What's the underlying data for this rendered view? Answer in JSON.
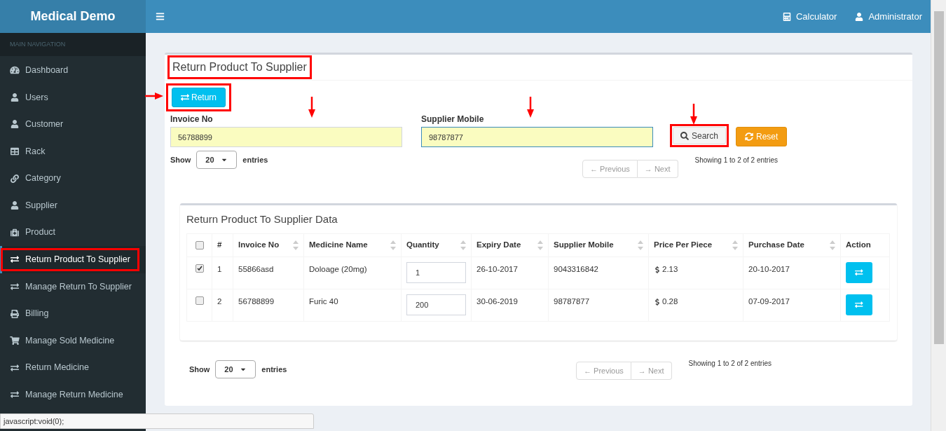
{
  "app": {
    "title": "Medical Demo"
  },
  "header": {
    "items": [
      "Calculator",
      "Administrator"
    ]
  },
  "sidebar": {
    "heading": "MAIN NAVIGATION",
    "items": [
      {
        "label": "Dashboard",
        "selected": false,
        "annotated": false
      },
      {
        "label": "Users",
        "selected": false,
        "annotated": false
      },
      {
        "label": "Customer",
        "selected": false,
        "annotated": false
      },
      {
        "label": "Rack",
        "selected": false,
        "annotated": false
      },
      {
        "label": "Category",
        "selected": false,
        "annotated": false
      },
      {
        "label": "Supplier",
        "selected": false,
        "annotated": false
      },
      {
        "label": "Product",
        "selected": false,
        "annotated": false
      },
      {
        "label": "Return Product To Supplier",
        "selected": true,
        "annotated": true
      },
      {
        "label": "Manage Return To Supplier",
        "selected": false,
        "annotated": false
      },
      {
        "label": "Billing",
        "selected": false,
        "annotated": false
      },
      {
        "label": "Manage Sold Medicine",
        "selected": false,
        "annotated": false
      },
      {
        "label": "Return Medicine",
        "selected": false,
        "annotated": false
      },
      {
        "label": "Manage Return Medicine",
        "selected": false,
        "annotated": false
      }
    ]
  },
  "panel": {
    "title": "Return Product To Supplier",
    "title_annotated": true,
    "return_button": {
      "label": "Return",
      "annotated": true
    },
    "fields": [
      {
        "label": "Invoice No",
        "value": "56788899",
        "focused": false
      },
      {
        "label": "Supplier Mobile",
        "value": "98787877",
        "focused": true
      }
    ],
    "search_button": {
      "label": "Search",
      "annotated": true
    },
    "reset_button": {
      "label": "Reset"
    },
    "top_length": {
      "show": "Show",
      "value": "20",
      "entries": "entries"
    },
    "top_pager": {
      "previous": "← Previous",
      "next": "→ Next"
    },
    "top_info": "Showing 1 to 2 of 2 entries"
  },
  "data_box": {
    "title": "Return Product To Supplier Data",
    "columns": [
      "#",
      "Invoice No",
      "Medicine Name",
      "Quantity",
      "Expiry Date",
      "Supplier Mobile",
      "Price Per Piece",
      "Purchase Date",
      "Action"
    ],
    "all_checked": false,
    "rows": [
      {
        "checked": true,
        "cells": [
          "1",
          "55866asd",
          "Doloage (20mg)"
        ],
        "quantity": "1",
        "rest": [
          "26-10-2017",
          "9043316842"
        ],
        "price": "2.13",
        "purchase": "20-10-2017"
      },
      {
        "checked": false,
        "cells": [
          "2",
          "56788899",
          "Furic 40"
        ],
        "quantity": "200",
        "rest": [
          "30-06-2019",
          "98787877"
        ],
        "price": "0.28",
        "purchase": "07-09-2017"
      }
    ]
  },
  "bottom_length": {
    "show": "Show",
    "value": "20",
    "entries": "entries"
  },
  "bottom_pager": {
    "previous": "← Previous",
    "next": "→ Next"
  },
  "bottom_info": "Showing 1 to 2 of 2 entries",
  "status_bar": "javascript:void(0);"
}
